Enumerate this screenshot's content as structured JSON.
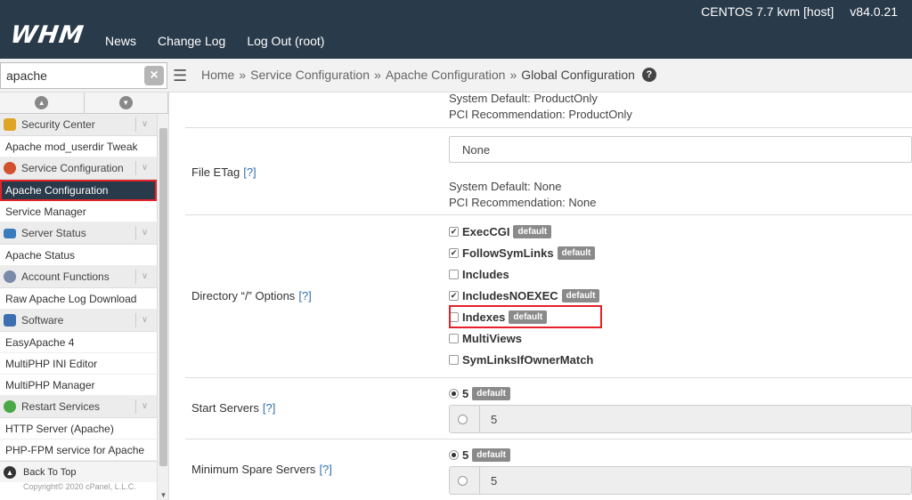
{
  "header": {
    "logo": "WHM",
    "nav": [
      "News",
      "Change Log",
      "Log Out (root)"
    ],
    "server": "CENTOS 7.7 kvm [host]",
    "version": "v84.0.21"
  },
  "search": {
    "value": "apache",
    "clear": "×"
  },
  "breadcrumb": {
    "home": "Home",
    "sep": "»",
    "service": "Service Configuration",
    "apache": "Apache Configuration",
    "current": "Global Configuration",
    "help": "?"
  },
  "sidebar": {
    "security": {
      "label": "Security Center",
      "color": "#e0a526"
    },
    "userdir": "Apache mod_userdir Tweak",
    "service": {
      "label": "Service Configuration",
      "color": "#d2522d"
    },
    "apache_config": "Apache Configuration",
    "service_manager": "Service Manager",
    "status": {
      "label": "Server Status",
      "color": "#3a7bbf"
    },
    "apache_status": "Apache Status",
    "account": {
      "label": "Account Functions",
      "color": "#7a8aa8"
    },
    "raw_log": "Raw Apache Log Download",
    "software": {
      "label": "Software",
      "color": "#3b6fb0"
    },
    "easyapache": "EasyApache 4",
    "multiphp_ini": "MultiPHP INI Editor",
    "multiphp_mgr": "MultiPHP Manager",
    "restart": {
      "label": "Restart Services",
      "color": "#4aa847"
    },
    "http_server": "HTTP Server (Apache)",
    "phpfpm": "PHP-FPM service for Apache",
    "back_top": "Back To Top",
    "copyright": "Copyright© 2020 cPanel, L.L.C."
  },
  "main": {
    "top_sysdef": "System Default: ProductOnly",
    "top_pci": "PCI Recommendation: ProductOnly",
    "etag": {
      "label": "File ETag",
      "help": "[?]",
      "select": "None",
      "sysdef": "System Default: None",
      "pci": "PCI Recommendation: None"
    },
    "dir_options": {
      "label": "Directory “/” Options",
      "help": "[?]",
      "items": [
        {
          "label": "ExecCGI",
          "checked": "✔",
          "badge": "default"
        },
        {
          "label": "FollowSymLinks",
          "checked": "✔",
          "badge": "default"
        },
        {
          "label": "Includes",
          "checked": "",
          "badge": ""
        },
        {
          "label": "IncludesNOEXEC",
          "checked": "✔",
          "badge": "default"
        },
        {
          "label": "Indexes",
          "checked": "",
          "badge": "default"
        },
        {
          "label": "MultiViews",
          "checked": "",
          "badge": ""
        },
        {
          "label": "SymLinksIfOwnerMatch",
          "checked": "",
          "badge": ""
        }
      ]
    },
    "start_servers": {
      "label": "Start Servers",
      "help": "[?]",
      "default_val": "5",
      "badge": "default",
      "custom": "5"
    },
    "min_spare": {
      "label": "Minimum Spare Servers",
      "help": "[?]",
      "default_val": "5",
      "badge": "default",
      "custom": "5"
    }
  }
}
